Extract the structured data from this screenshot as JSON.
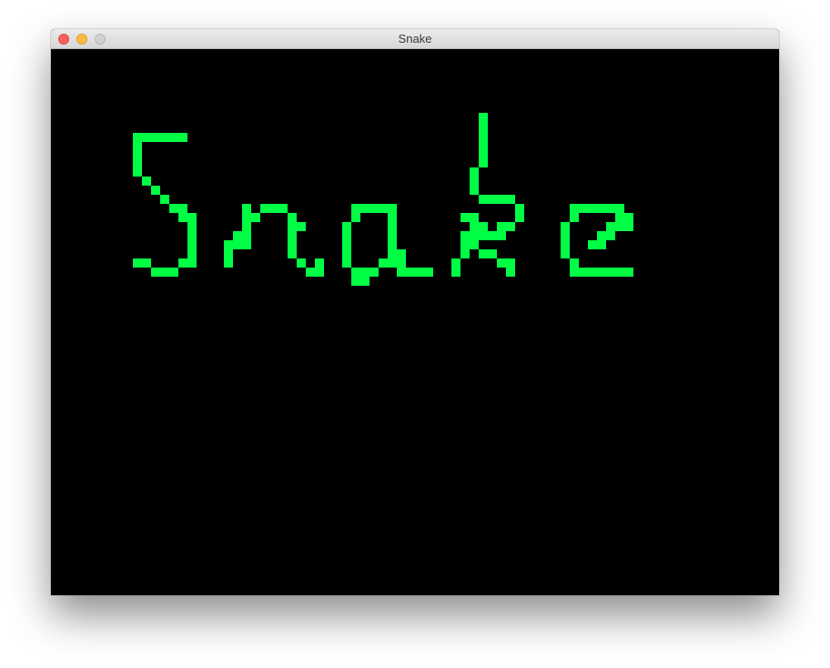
{
  "window": {
    "title": "Snake",
    "buttons": {
      "close": "close-icon",
      "minimize": "minimize-icon",
      "zoom": "zoom-icon"
    }
  },
  "game": {
    "background_color": "#000000",
    "pixel_color": "#00ff44",
    "title_art_text": "Snake"
  }
}
